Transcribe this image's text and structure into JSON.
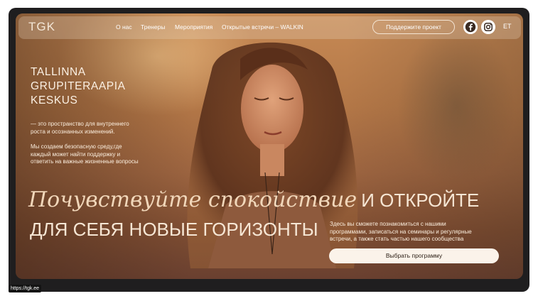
{
  "header": {
    "logo": "TGK",
    "nav": [
      "О нас",
      "Тренеры",
      "Мероприятия",
      "Открытые встречи – WALKIN"
    ],
    "support_label": "Поддержите проект",
    "social_icons": [
      "facebook-icon",
      "instagram-icon"
    ],
    "lang": "ET"
  },
  "brand": {
    "lines": [
      "TALLINNA",
      "GRUPITERAAPIA",
      "KESKUS"
    ],
    "tagline_lines": [
      "— это пространство для внутреннего",
      "роста и осознанных изменений."
    ],
    "mission_lines": [
      "Мы создаем безопасную среду,где",
      "каждый может найти поддержку и",
      "ответить на важные жизненные вопросы"
    ]
  },
  "hero": {
    "headline_italic": "Почувствуйте спокойствие",
    "headline_upper_1": "И ОТКРОЙТЕ",
    "headline_upper_2": "ДЛЯ СЕБЯ НОВЫЕ ГОРИЗОНТЫ",
    "side_lines": [
      "Здесь вы сможете познакомиться с нашими",
      "программами, записаться на семинары и регулярные",
      "встречи, а также стать частью нашего сообщества"
    ],
    "cta_label": "Выбрать программу"
  },
  "status_bar": {
    "url": "https://tgk.ee"
  },
  "colors": {
    "frame": "#1f1e1f",
    "accent_warm": "#c78a55",
    "button_bg": "#fbf3ea"
  }
}
